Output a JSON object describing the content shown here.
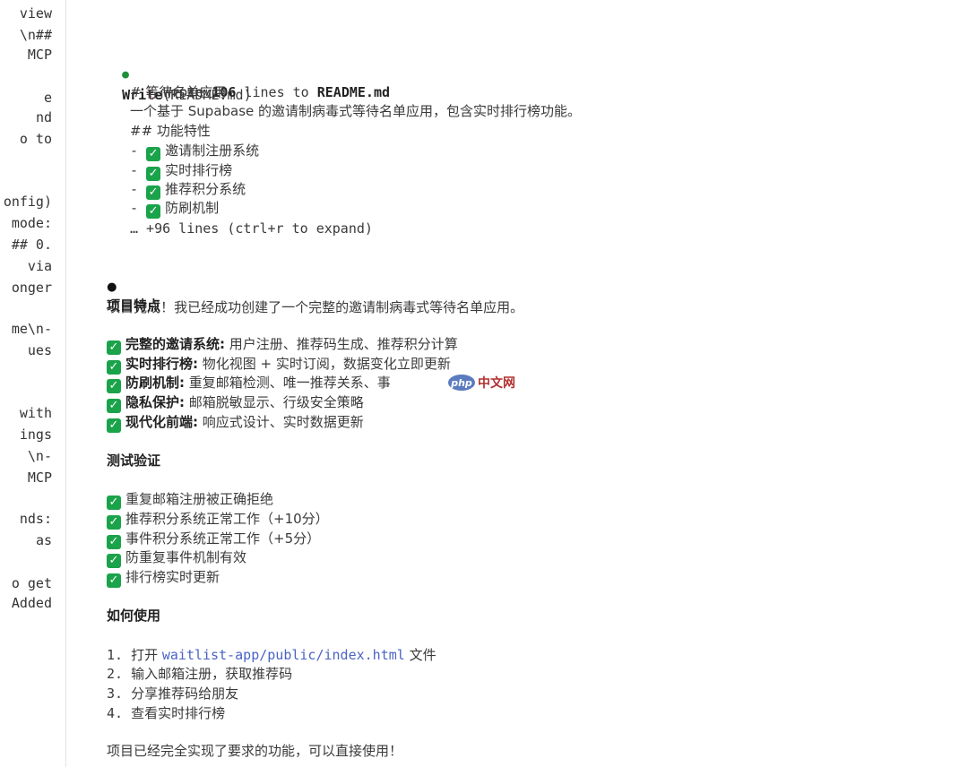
{
  "left_panel": {
    "lines": [
      "view",
      "\\n##",
      "MCP",
      "",
      "e",
      "nd",
      "o to",
      "",
      "",
      "onfig)",
      "mode:",
      "## 0.",
      "via",
      "onger",
      "",
      "me\\n-",
      "ues",
      "",
      "",
      "with",
      "ings",
      "\\n-",
      "MCP",
      "",
      "nds:",
      "as",
      "",
      "o get",
      "Added"
    ]
  },
  "write_block": {
    "tool_name": "Write",
    "tool_arg": "(README.md)",
    "result_prefix": "Wrote ",
    "line_count": "106",
    "result_mid": " lines to ",
    "file_name": "README.md",
    "preview": {
      "h1": "# 等待名单应用",
      "desc": "一个基于 Supabase 的邀请制病毒式等待名单应用，包含实时排行榜功能。",
      "h2": "## 功能特性",
      "items": [
        "邀请制注册系统",
        "实时排行榜",
        "推荐积分系统",
        "防刷机制"
      ]
    },
    "more": "… +96 lines (ctrl+r to expand)"
  },
  "summary": {
    "intro": "项目完成！我已经成功创建了一个完整的邀请制病毒式等待名单应用。",
    "features_title": "项目特点",
    "features": [
      {
        "label": "完整的邀请系统:",
        "text": " 用户注册、推荐码生成、推荐积分计算"
      },
      {
        "label": "实时排行榜:",
        "text": " 物化视图 + 实时订阅，数据变化立即更新"
      },
      {
        "label": "防刷机制:",
        "text": " 重复邮箱检测、唯一推荐关系、事"
      },
      {
        "label": "隐私保护:",
        "text": " 邮箱脱敏显示、行级安全策略"
      },
      {
        "label": "现代化前端:",
        "text": " 响应式设计、实时数据更新"
      }
    ],
    "tests_title": "测试验证",
    "tests": [
      "重复邮箱注册被正确拒绝",
      "推荐积分系统正常工作（+10分）",
      "事件积分系统正常工作（+5分）",
      "防重复事件机制有效",
      "排行榜实时更新"
    ],
    "usage_title": "如何使用",
    "usage": [
      {
        "num": "1.",
        "pre": "打开 ",
        "link": "waitlist-app/public/index.html",
        "post": " 文件"
      },
      {
        "num": "2.",
        "pre": "输入邮箱注册，获取推荐码",
        "link": "",
        "post": ""
      },
      {
        "num": "3.",
        "pre": "分享推荐码给朋友",
        "link": "",
        "post": ""
      },
      {
        "num": "4.",
        "pre": "查看实时排行榜",
        "link": "",
        "post": ""
      }
    ],
    "closing": "项目已经完全实现了要求的功能，可以直接使用！"
  },
  "watermark": {
    "badge": "php",
    "text": "中文网"
  },
  "colors": {
    "check": "#1aa34a",
    "link": "#4b63c6",
    "green_dot": "#1f8f3a"
  }
}
